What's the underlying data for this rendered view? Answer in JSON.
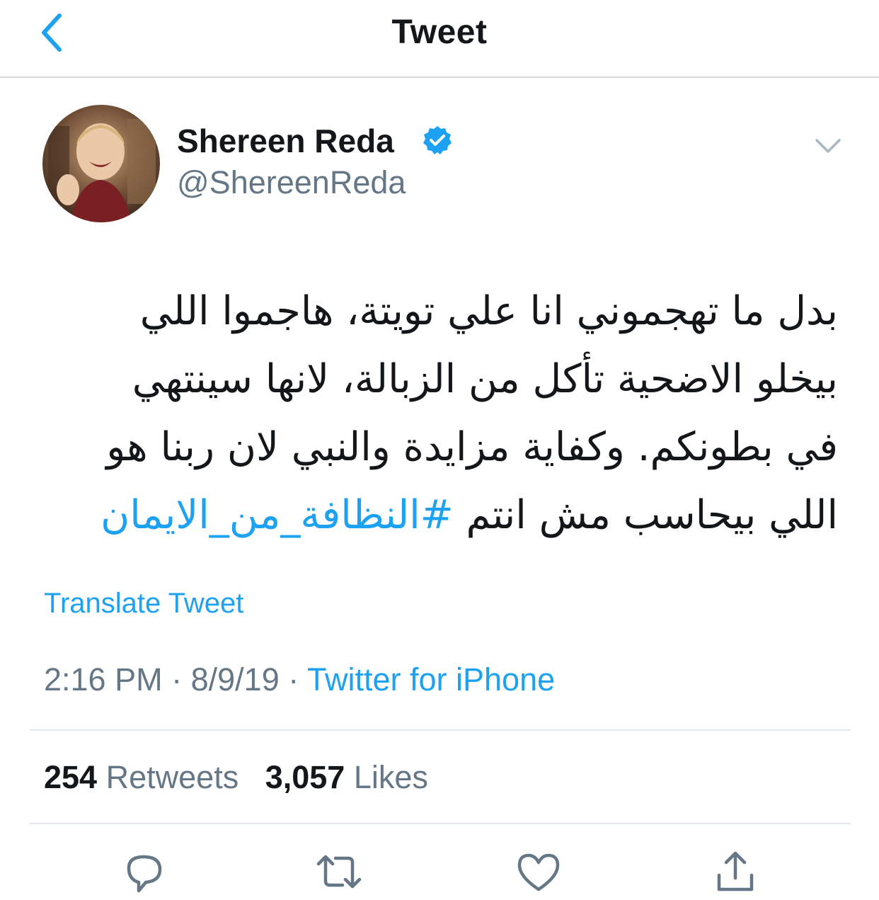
{
  "nav": {
    "title": "Tweet",
    "back_icon": "chevron-left-icon"
  },
  "author": {
    "name": "Shereen Reda",
    "handle": "@ShereenReda",
    "verified": true,
    "verified_color": "#1da1f2"
  },
  "tweet": {
    "lines": [
      "بدل ما تهجموني انا علي تويتة، هاجموا اللي",
      "بيخلو الاضحية تأكل من الزبالة، لانها سينتهي",
      "في بطونكم. وكفاية مزايدة والنبي لان ربنا هو",
      "اللي بيحاسب مش انتم"
    ],
    "hashtag": "#النظافة_من_الايمان"
  },
  "translate_label": "Translate Tweet",
  "meta": {
    "time": "2:16 PM",
    "separator": "·",
    "date": "8/9/19",
    "source": "Twitter for iPhone"
  },
  "stats": {
    "retweets_count": "254",
    "retweets_label": "Retweets",
    "likes_count": "3,057",
    "likes_label": "Likes"
  },
  "actions": [
    "reply-icon",
    "retweet-icon",
    "like-icon",
    "share-icon"
  ],
  "colors": {
    "accent": "#1da1f2",
    "text": "#14171a",
    "secondary": "#657786",
    "divider": "#e1e8ed"
  }
}
